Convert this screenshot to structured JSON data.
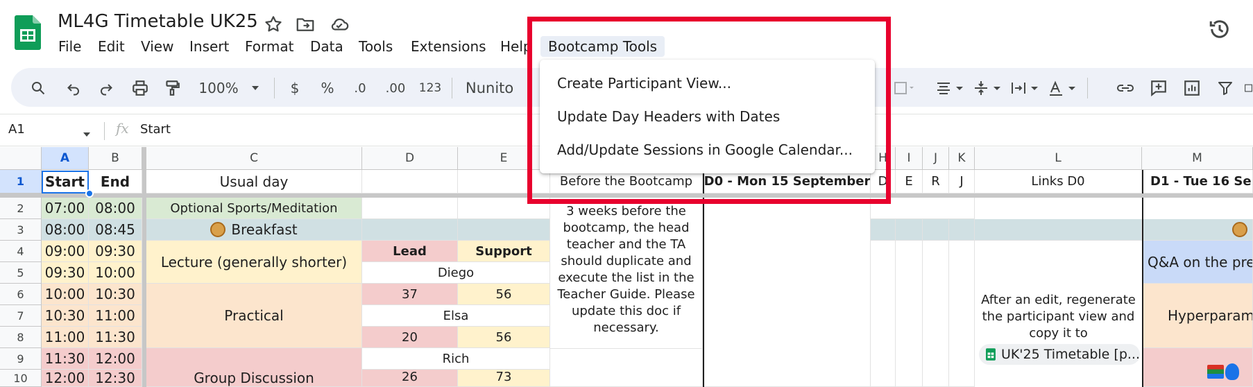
{
  "app": {
    "title": "ML4G Timetable UK25",
    "menu": [
      "File",
      "Edit",
      "View",
      "Insert",
      "Format",
      "Data",
      "Tools",
      "Extensions",
      "Help",
      "Bootcamp Tools"
    ],
    "history_icon": "history-icon"
  },
  "toolbar": {
    "zoom": "100%",
    "currency": "$",
    "percent": "%",
    "decrease_decimal": ".0",
    "increase_decimal": ".00",
    "number_format": "123",
    "font": "Nunito"
  },
  "formula_bar": {
    "cell_ref": "A1",
    "fx": "fx",
    "value": "Start"
  },
  "dropdown": {
    "items": [
      "Create Participant View...",
      "Update Day Headers with Dates",
      "Add/Update Sessions in Google Calendar..."
    ]
  },
  "grid": {
    "columns": [
      "A",
      "B",
      "C",
      "D",
      "E",
      "H",
      "I",
      "J",
      "K",
      "L",
      "M"
    ],
    "rows": [
      "1",
      "2",
      "3",
      "4",
      "5",
      "6",
      "7",
      "8",
      "9",
      "10"
    ],
    "header_row": {
      "start": "Start",
      "end": "End",
      "usual_day": "Usual day",
      "before": "Before the Bootcamp",
      "d0": "D0 - Mon 15 September",
      "h": "D",
      "i": "E",
      "j": "R",
      "k": "J",
      "links": "Links D0",
      "d1": "D1 - Tue 16 Sep"
    },
    "times": [
      [
        "07:00",
        "08:00"
      ],
      [
        "08:00",
        "08:45"
      ],
      [
        "09:00",
        "09:30"
      ],
      [
        "09:30",
        "10:00"
      ],
      [
        "10:00",
        "10:30"
      ],
      [
        "10:30",
        "11:00"
      ],
      [
        "11:00",
        "11:30"
      ],
      [
        "11:30",
        "12:00"
      ],
      [
        "12:00",
        "12:30"
      ]
    ],
    "usual_day": {
      "sports": "Optional Sports/Meditation",
      "breakfast": "Breakfast",
      "lecture": "Lecture (generally shorter)",
      "practical": "Practical",
      "discussion": "Group Discussion"
    },
    "lead_support": {
      "lead": "Lead",
      "support": "Support",
      "r5": "Diego",
      "r6_lead": "37",
      "r6_support": "56",
      "r7": "Elsa",
      "r8_lead": "20",
      "r8_support": "56",
      "r9": "Rich",
      "r10_lead": "26",
      "r10_support": "73"
    },
    "before_note": "3 weeks before the bootcamp, the head teacher and the TA should duplicate and execute the list in the Teacher Guide. Please update this doc if necessary.",
    "links_note": "After an edit, regenerate the participant view and copy it to",
    "chip_label": "UK'25 Timetable [p...",
    "d1": {
      "qa": "Q&A on the prere",
      "hyper": "Hyperparam"
    }
  },
  "colors": {
    "highlight": "#e8002d",
    "selection": "#1a73e8",
    "sheets_green": "#0f9d58"
  }
}
